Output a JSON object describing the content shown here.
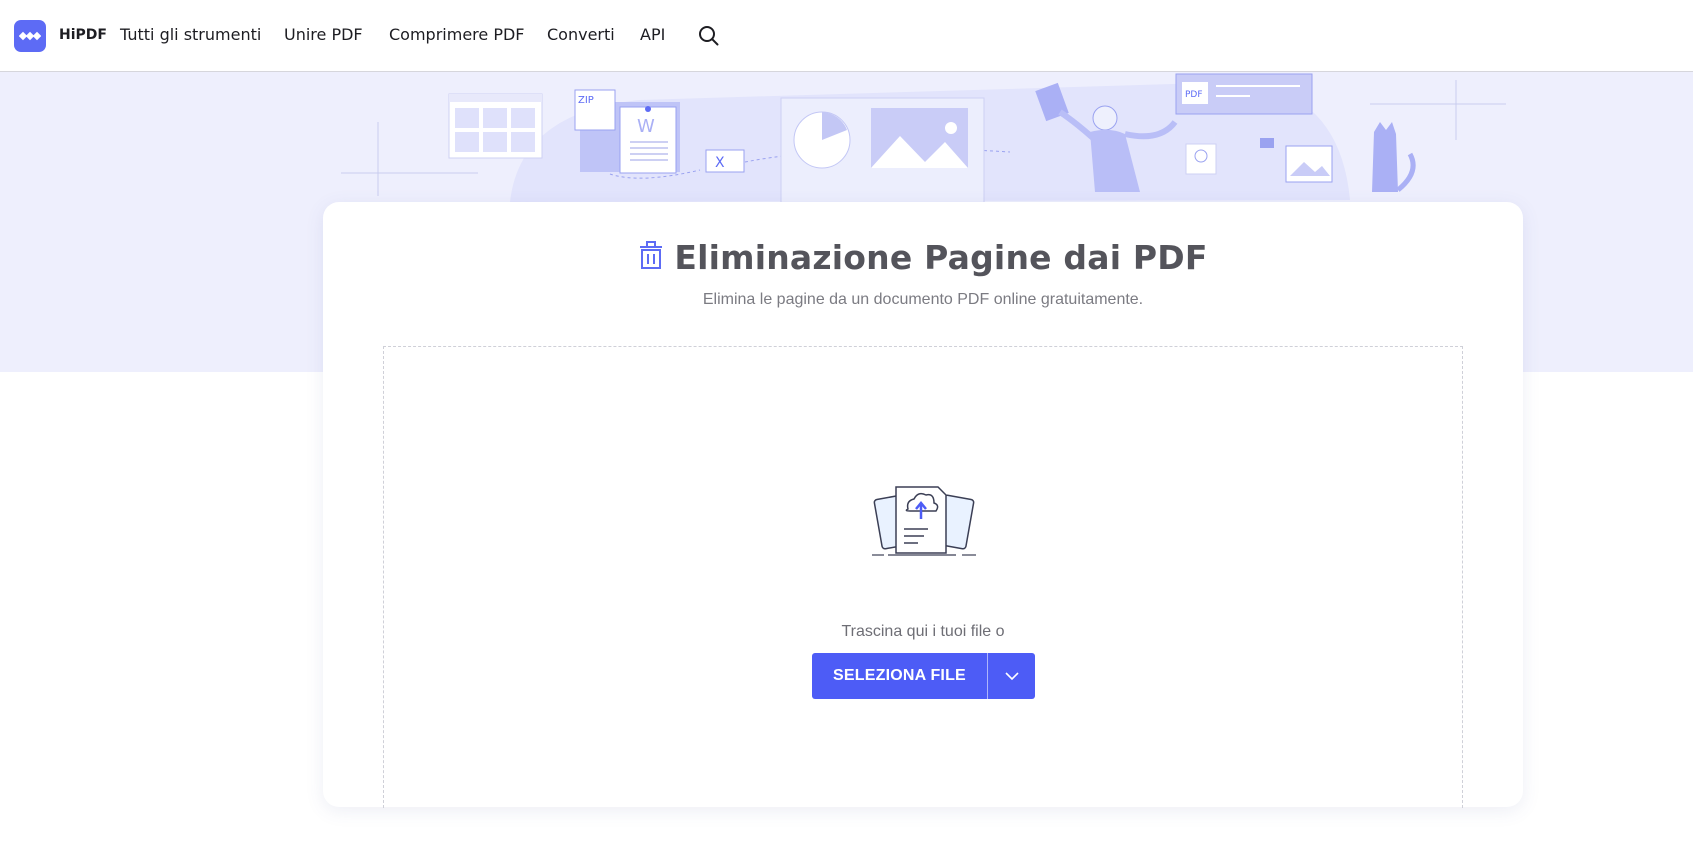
{
  "header": {
    "brand": "HiPDF",
    "nav": [
      {
        "label": "Tutti gli strumenti"
      },
      {
        "label": "Unire PDF"
      },
      {
        "label": "Comprimere PDF"
      },
      {
        "label": "Converti"
      },
      {
        "label": "API"
      }
    ],
    "search_icon": "search-icon"
  },
  "hero": {
    "illustration_labels": {
      "zip": "ZIP",
      "word": "W",
      "excel": "X",
      "pdf": "PDF"
    }
  },
  "tool": {
    "title_icon": "trash-icon",
    "title": "Eliminazione Pagine dai PDF",
    "subtitle": "Elimina le pagine da un documento PDF online gratuitamente."
  },
  "upload": {
    "illustration_icon": "cloud-upload-document-icon",
    "drop_text": "Trascina qui i tuoi file o",
    "button_label": "SELEZIONA FILE",
    "dropdown_icon": "chevron-down-icon"
  },
  "colors": {
    "accent": "#4d5cf6",
    "hero_bg": "#eeeffd",
    "title": "#54545b",
    "text_muted": "#7b7b82"
  }
}
